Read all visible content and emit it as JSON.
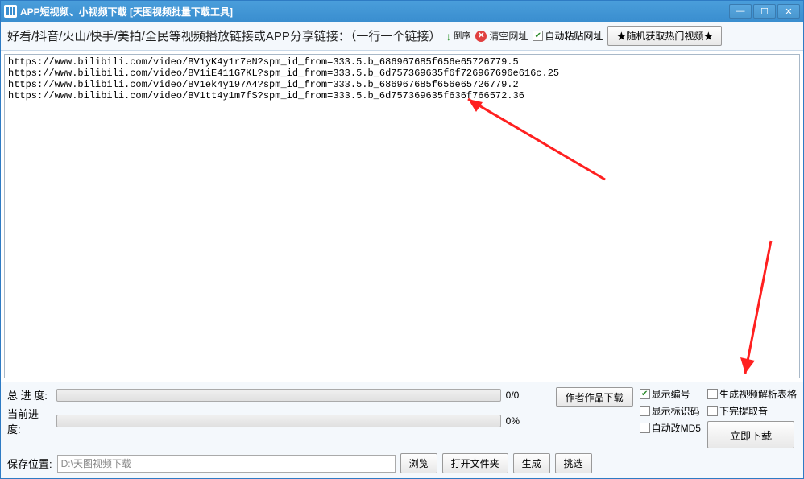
{
  "titlebar": {
    "title": "APP短视频、小视频下载 [天图视频批量下载工具]"
  },
  "toolbar": {
    "label": "好看/抖音/火山/快手/美拍/全民等视频播放链接或APP分享链接：（一行一个链接）",
    "sort_label": "倒序",
    "clear_label": "清空网址",
    "autopaste_label": "自动粘贴网址",
    "random_label": "★随机获取热门视频★"
  },
  "urls": "https://www.bilibili.com/video/BV1yK4y1r7eN?spm_id_from=333.5.b_686967685f656e65726779.5\nhttps://www.bilibili.com/video/BV1iE411G7KL?spm_id_from=333.5.b_6d757369635f6f726967696e616c.25\nhttps://www.bilibili.com/video/BV1ek4y197A4?spm_id_from=333.5.b_686967685f656e65726779.2\nhttps://www.bilibili.com/video/BV1tt4y1m7fS?spm_id_from=333.5.b_6d757369635f636f766572.36",
  "progress": {
    "total_label": "总 进 度:",
    "total_text": "0/0",
    "current_label": "当前进度:",
    "current_text": "0%"
  },
  "savepath": {
    "label": "保存位置:",
    "value": "D:\\天图视频下载",
    "browse_label": "浏览",
    "openfolder_label": "打开文件夹",
    "generate_label": "生成",
    "pick_label": "挑选"
  },
  "buttons": {
    "author_works": "作者作品下载",
    "download_now": "立即下载"
  },
  "options": {
    "show_number": "显示编号",
    "show_idcode": "显示标识码",
    "auto_md5": "自动改MD5",
    "gen_parse_table": "生成视频解析表格",
    "no_extract_audio": "下完提取音"
  }
}
